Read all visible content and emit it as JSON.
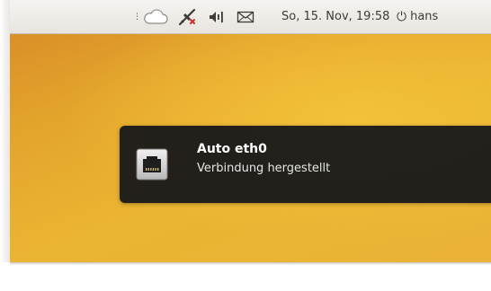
{
  "panel": {
    "indicators": [
      {
        "icon": "weather-cloud-icon"
      },
      {
        "icon": "network-disconnected-icon"
      },
      {
        "icon": "volume-icon"
      },
      {
        "icon": "mail-icon"
      }
    ],
    "clock": "So, 15. Nov, 19:58",
    "user": "hans"
  },
  "notification": {
    "icon": "network-ethernet-icon",
    "title": "Auto eth0",
    "body": "Verbindung hergestellt"
  },
  "colors": {
    "panel_bg": "#eceae6",
    "panel_text": "#3c3b37",
    "notification_bg": "#1a1a1a",
    "wallpaper_dark": "#d68828",
    "wallpaper_light": "#f3c13a"
  }
}
